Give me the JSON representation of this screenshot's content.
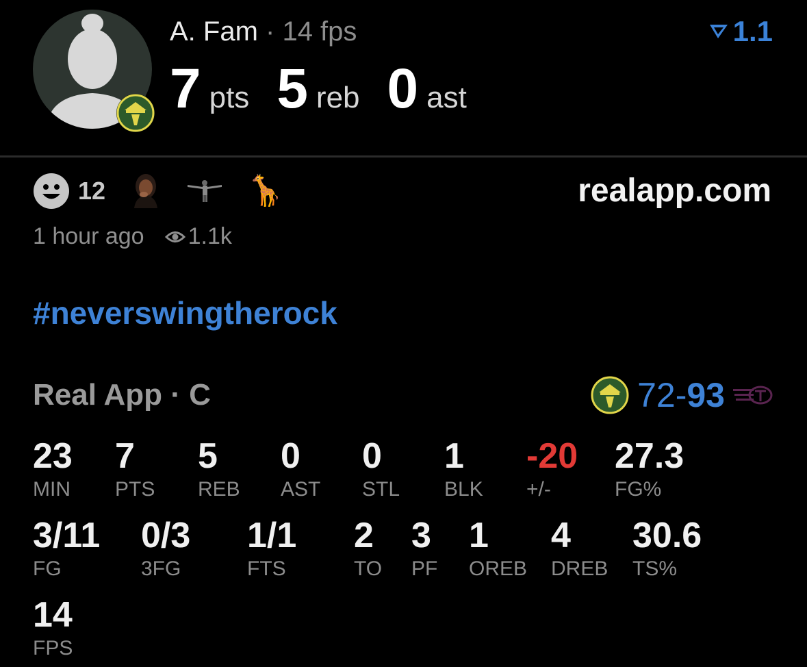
{
  "header": {
    "player_name": "A. Fam",
    "player_meta": " · 14 fps",
    "rating": "1.1",
    "headline": [
      {
        "value": "7",
        "unit": "pts"
      },
      {
        "value": "5",
        "unit": "reb"
      },
      {
        "value": "0",
        "unit": "ast"
      }
    ]
  },
  "reactions": {
    "count": "12",
    "icons": [
      "smiley-icon",
      "reaction-person-icon",
      "reaction-player-icon",
      "giraffe-icon"
    ]
  },
  "site": "realapp.com",
  "meta": {
    "time": "1 hour ago",
    "views": "1.1k"
  },
  "hashtag": "#neverswingtherock",
  "game": {
    "league": "Real App · C",
    "score_home": "72",
    "score_sep": "-",
    "score_away": "93"
  },
  "stats_row1": [
    {
      "value": "23",
      "label": "MIN"
    },
    {
      "value": "7",
      "label": "PTS"
    },
    {
      "value": "5",
      "label": "REB"
    },
    {
      "value": "0",
      "label": "AST"
    },
    {
      "value": "0",
      "label": "STL"
    },
    {
      "value": "1",
      "label": "BLK"
    },
    {
      "value": "-20",
      "label": "+/-"
    },
    {
      "value": "27.3",
      "label": "FG%"
    }
  ],
  "stats_row2": [
    {
      "value": "3/11",
      "label": "FG"
    },
    {
      "value": "0/3",
      "label": "3FG"
    },
    {
      "value": "1/1",
      "label": "FTS"
    },
    {
      "value": "2",
      "label": "TO"
    },
    {
      "value": "3",
      "label": "PF"
    },
    {
      "value": "1",
      "label": "OREB"
    },
    {
      "value": "4",
      "label": "DREB"
    },
    {
      "value": "30.6",
      "label": "TS%"
    }
  ],
  "stats_row3": [
    {
      "value": "14",
      "label": "FPS"
    }
  ],
  "colors": {
    "accent": "#3e82d6",
    "negative": "#e23a36",
    "team_green": "#2c5a2a",
    "team_yellow": "#e2d64a"
  }
}
